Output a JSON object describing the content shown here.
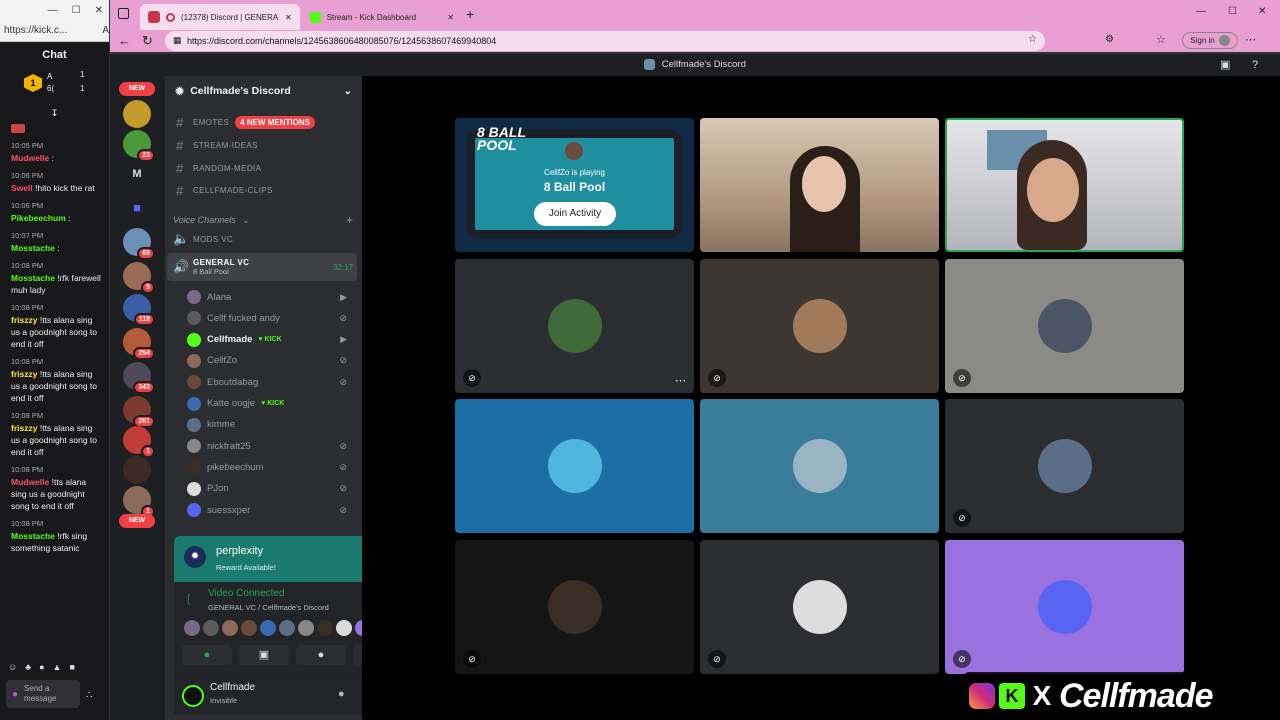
{
  "chat_window": {
    "url": "https://kick.c...",
    "title": "Chat",
    "counts": {
      "a_label": "A",
      "a_val": "1",
      "b_val": "6(",
      "c_val": "1"
    },
    "messages": [
      {
        "time": "10:05 PM",
        "user": "Mudwelle",
        "text": ":",
        "color": "#ff4d6a"
      },
      {
        "time": "10:06 PM",
        "user": "Swell",
        "text": "!hito kick the rat",
        "color": "#ff4d6a"
      },
      {
        "time": "10:06 PM",
        "user": "Pikebeechum",
        "text": ":",
        "color": "#53fc18"
      },
      {
        "time": "10:07 PM",
        "user": "Mosstache",
        "text": ":",
        "color": "#53fc18"
      },
      {
        "time": "10:08 PM",
        "user": "Mosstache",
        "text": "!rfk farewell muh lady",
        "color": "#53fc18"
      },
      {
        "time": "10:08 PM",
        "user": "friszzy",
        "text": "!tts alana sing us a goodnight song to end it off",
        "color": "#f5e642"
      },
      {
        "time": "10:08 PM",
        "user": "friszzy",
        "text": "!tts alana sing us a goodnight song to end it off",
        "color": "#f5e642"
      },
      {
        "time": "10:08 PM",
        "user": "friszzy",
        "text": "!tts alana sing us a goodnight song to end it off",
        "color": "#f5e642"
      },
      {
        "time": "10:08 PM",
        "user": "Mudwelle",
        "text": "!tts alana sing us a goodnight song to end it off",
        "color": "#ff4d6a"
      },
      {
        "time": "10:08 PM",
        "user": "Mosstache",
        "text": "!rfk sing something satanic",
        "color": "#53fc18"
      }
    ],
    "input_placeholder": "Send a message"
  },
  "tabs": [
    {
      "label": "(12378) Discord | GENERAL VC"
    },
    {
      "label": "Stream - Kick Dashboard"
    }
  ],
  "address": "https://discord.com/channels/1245638606480085076/1245638607469940804",
  "signin": "Sign in",
  "discord_title": "Cellfmade's Discord",
  "servers": {
    "new_top": "NEW",
    "new_bottom": "NEW",
    "badges": [
      "23",
      "69",
      "5",
      "118",
      "254",
      "343",
      "261",
      "1",
      "1"
    ],
    "dm_letter": "M"
  },
  "sidebar": {
    "server_name": "Cellfmade's Discord",
    "text_channels": [
      {
        "name": "EMOTES",
        "mention": "4 NEW MENTIONS"
      },
      {
        "name": "STREAM-IDEAS"
      },
      {
        "name": "RANDOM-MEDIA"
      },
      {
        "name": "CELLFMADE-CLIPS"
      }
    ],
    "voice_header": "Voice Channels",
    "voice_channels": [
      {
        "name": "MODS VC"
      },
      {
        "name": "GENERAL VC",
        "timer": "32:17",
        "activity": "8 Ball Pool"
      }
    ],
    "voice_users": [
      {
        "name": "Alana",
        "icon": "camera-icon"
      },
      {
        "name": "Cellf fucked andy",
        "icon": "mic-muted-icon"
      },
      {
        "name": "Cellfmade",
        "badge": "KICK",
        "icon": "camera-icon"
      },
      {
        "name": "CellfZo",
        "icon": "mic-muted-icon"
      },
      {
        "name": "Eboutdabag",
        "icon": "mic-muted-icon"
      },
      {
        "name": "Katte oogje",
        "badge": "KICK"
      },
      {
        "name": "kimme"
      },
      {
        "name": "nickfratt25",
        "icon": "mic-muted-icon"
      },
      {
        "name": "pikebeechum",
        "icon": "mic-muted-icon"
      },
      {
        "name": "PJon",
        "icon": "mic-muted-icon"
      },
      {
        "name": "suessxper",
        "icon": "mic-muted-icon"
      }
    ]
  },
  "promo": {
    "title": "perplexity",
    "subtitle": "Reward Available!"
  },
  "voice_panel": {
    "status": "Video Connected",
    "channel": "GENERAL VC / Cellfmade's Discord"
  },
  "user_panel": {
    "name": "Cellfmade",
    "status": "Invisible"
  },
  "activity": {
    "caption": "CellfZo is playing",
    "game": "8 Ball Pool",
    "button": "Join Activity",
    "logo": "8 BALL POOL"
  },
  "overlay": {
    "handle": "Cellfmade"
  },
  "colors": {
    "accent": "#5865f2",
    "mention": "#f23f43",
    "speaking": "#23a55a",
    "kick": "#53fc18"
  }
}
